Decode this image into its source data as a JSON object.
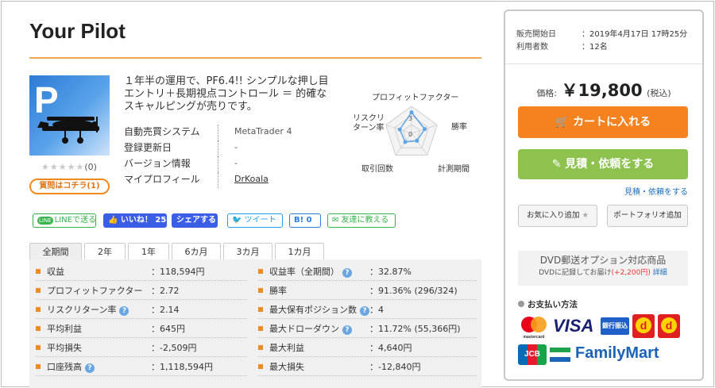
{
  "product": {
    "title": "Your Pilot",
    "thumb_letter": "P",
    "rating_stars": "★★★★★",
    "rating_count": "(0)",
    "question_button": "質問はコチラ(1)",
    "description": "１年半の運用で、PF6.4!! シンプルな押し目エントリ＋長期視点コントロール ＝ 的確なスキャルピングが売りです。",
    "specs": [
      {
        "label": "自動売買システム",
        "value": "MetaTrader 4"
      },
      {
        "label": "登録更新日",
        "value": "-"
      },
      {
        "label": "バージョン情報",
        "value": "-"
      },
      {
        "label": "マイプロフィール",
        "value": "DrKoala"
      }
    ]
  },
  "radar": {
    "labels": {
      "top": "プロフィットファクター",
      "right": "勝率",
      "bottom_right": "計測期間",
      "bottom_left": "取引回数",
      "left": "リスクリ\nターン率"
    },
    "scale_top": "3",
    "scale_zero": "0",
    "values": {
      "profit_factor": 2.72,
      "win_rate": 1.8,
      "period": 1.2,
      "trades": 1.4,
      "risk_return": 1.6
    },
    "max": 3.5
  },
  "social": {
    "line": "LINEで送る",
    "line_badge": "LINE",
    "like": "👍 いいね！ 25",
    "share": "シェアする",
    "tweet": "ツイート",
    "hatena": "B! 0",
    "friend": "✉ 友達に教える"
  },
  "tabs": [
    "全期間",
    "2年",
    "1年",
    "6カ月",
    "3カ月",
    "1カ月"
  ],
  "stats_left": [
    {
      "label": "収益",
      "value": "：118,594円",
      "help": false
    },
    {
      "label": "プロフィットファクター",
      "value": "：2.72",
      "help": false
    },
    {
      "label": "リスクリターン率",
      "value": "：2.14",
      "help": true
    },
    {
      "label": "平均利益",
      "value": "：645円",
      "help": false
    },
    {
      "label": "平均損失",
      "value": "：-2,509円",
      "help": false
    },
    {
      "label": "口座残高",
      "value": "：1,118,594円",
      "help": true
    }
  ],
  "stats_right": [
    {
      "label": "収益率（全期間）",
      "value": "：32.87%",
      "help": true
    },
    {
      "label": "勝率",
      "value": "：91.36% (296/324)",
      "help": false
    },
    {
      "label": "最大保有ポジション数",
      "value": "：4",
      "help": true
    },
    {
      "label": "最大ドローダウン",
      "value": "：11.72% (55,366円)",
      "help": true
    },
    {
      "label": "最大利益",
      "value": "：4,640円",
      "help": false
    },
    {
      "label": "最大損失",
      "value": "：-12,840円",
      "help": false
    }
  ],
  "sidebar": {
    "release_label": "販売開始日",
    "release_value": "：2019年4月17日 17時25分",
    "users_label": "利用者数",
    "users_value": "：12名",
    "price_label": "価格:",
    "price_value": "￥19,800",
    "price_tax": "(税込)",
    "cart_button": "カートに入れる",
    "quote_button": "見積・依頼をする",
    "quote_link": "見積・依頼をする",
    "favorite_button": "お気に入り追加",
    "portfolio_button": "ポートフォリオ追加",
    "dvd_title": "DVD郵送オプション対応商品",
    "dvd_sub": "DVDに記録してお届け",
    "dvd_price": "(+2,200円)",
    "dvd_detail": "詳細",
    "payment_title": "お支払い方法",
    "payment_logos": [
      "mastercard",
      "VISA",
      "銀行振込",
      "d",
      "d",
      "JCB",
      "FamilyMart"
    ]
  },
  "colors": {
    "accent_orange": "#f5821f",
    "green": "#8dc24f",
    "rule": "#f0a64a"
  }
}
